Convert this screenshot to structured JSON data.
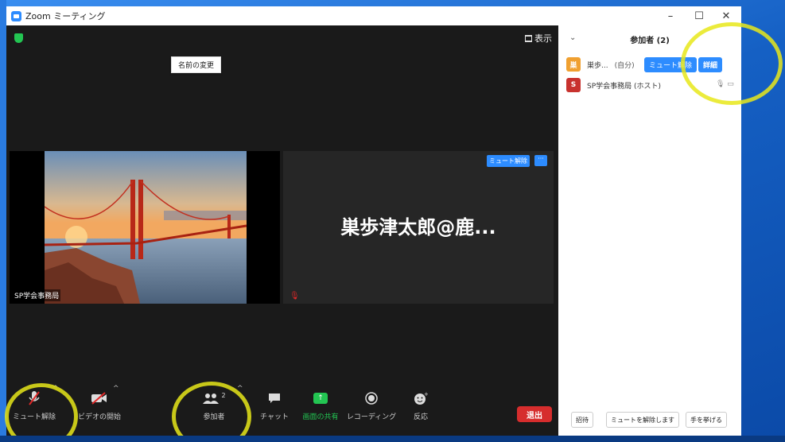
{
  "window": {
    "title": "Zoom ミーティング"
  },
  "video": {
    "view_label": "表示",
    "tile1_name": "SP学会事務局",
    "tile2_name": "巣歩津太郎@鹿...",
    "tile2_unmute": "ミュート解除",
    "tile2_more": "···"
  },
  "toolbar": {
    "unmute": "ミュート解除",
    "start_video": "ビデオの開始",
    "participants": "参加者",
    "participants_count": "2",
    "chat": "チャット",
    "share": "画面の共有",
    "record": "レコーディング",
    "reactions": "反応",
    "leave": "退出"
  },
  "panel": {
    "title": "参加者 (2)",
    "participants": [
      {
        "avatar": "巣",
        "name": "巣歩...",
        "tag": "(自分)",
        "color": "#f0a030"
      },
      {
        "avatar": "S",
        "name": "SP学会事務局 (ホスト)",
        "color": "#c8322e"
      }
    ],
    "unmute_btn": "ミュート解除",
    "more_btn": "詳細",
    "rename_menu": "名前の変更",
    "invite": "招待",
    "mute_all": "ミュートを解除します",
    "raise_hand": "手を挙げる"
  },
  "colors": {
    "accent": "#2d8cff",
    "leave": "#d62d2d",
    "share": "#23c552",
    "highlight": "#e8e81a"
  }
}
